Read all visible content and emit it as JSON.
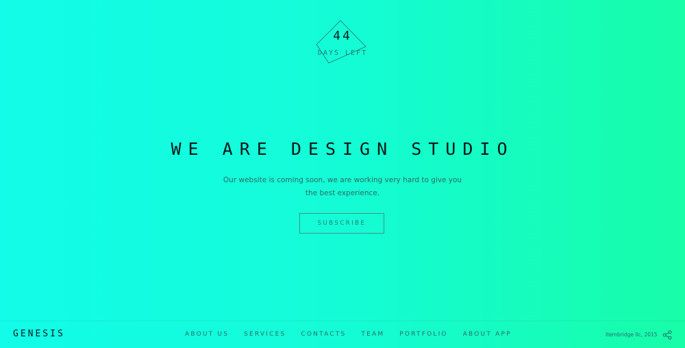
{
  "countdown": {
    "number": "44",
    "label": "DAYS LEFT"
  },
  "hero": {
    "title": "WE ARE DESIGN STUDIO",
    "subtitle": "Our website is coming soon, we are working very hard to give you the best experience.",
    "button_label": "SUBSCRIBE"
  },
  "footer": {
    "brand": "GENESIS",
    "nav": [
      "ABOUT US",
      "SERVICES",
      "CONTACTS",
      "TEAM",
      "PORTFOLIO",
      "ABOUT APP"
    ],
    "copyright": "itembridge llc, 2015",
    "share_icon": "share-icon"
  },
  "colors": {
    "background_start": "#12fce9",
    "background_end": "#17fda8",
    "text_dark": "#0b1b1b",
    "text_muted": "#2d6b63"
  }
}
